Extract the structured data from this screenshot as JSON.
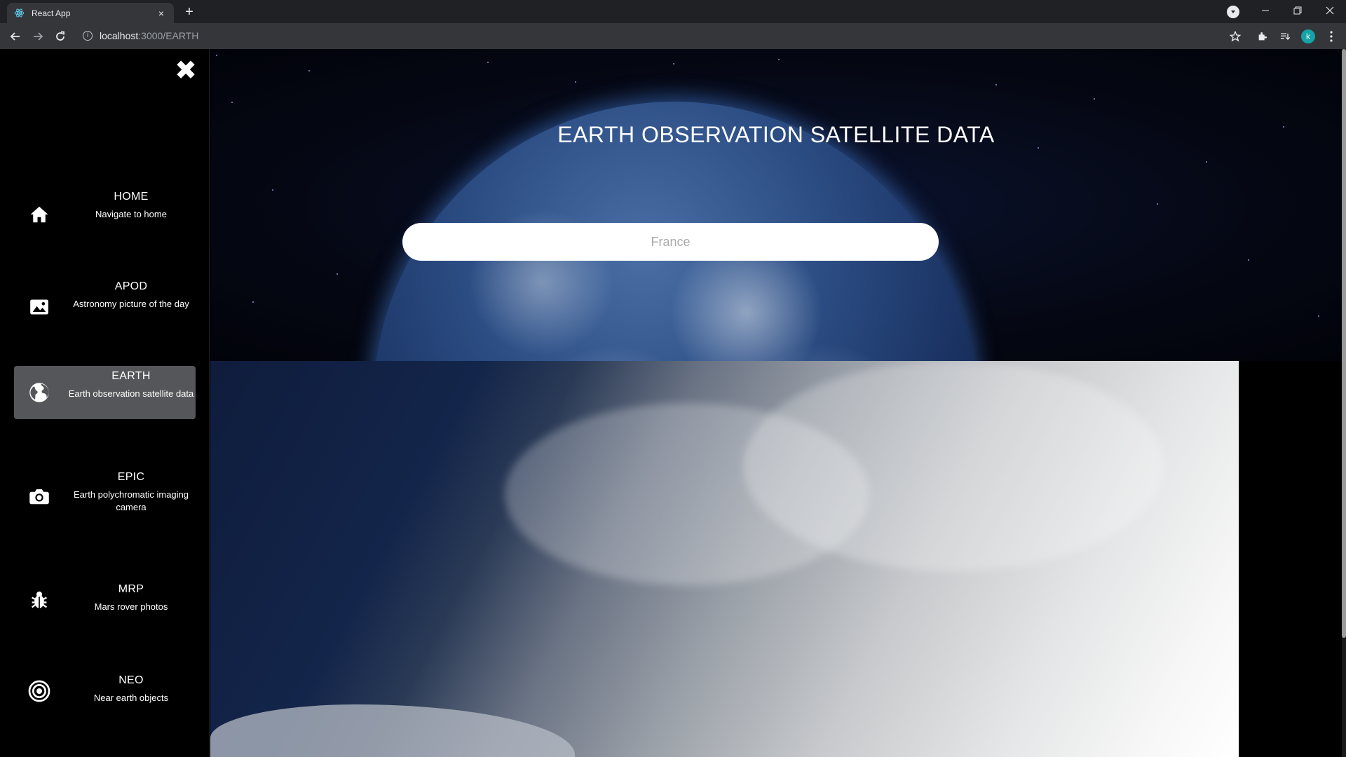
{
  "browser": {
    "tab_title": "React App",
    "tab_close": "×",
    "new_tab": "+",
    "url_host": "localhost",
    "url_path": ":3000/EARTH",
    "avatar_letter": "k",
    "icons": [
      "back-arrow-icon",
      "forward-arrow-icon",
      "reload-icon",
      "info-icon",
      "star-icon",
      "extensions-icon",
      "reading-list-icon",
      "more-vertical-icon",
      "minimize-icon",
      "restore-icon",
      "close-icon"
    ]
  },
  "sidebar": {
    "close_symbol": "✖",
    "items": [
      {
        "title": "HOME",
        "subtitle": "Navigate to home",
        "icon": "home-icon",
        "active": false
      },
      {
        "title": "APOD",
        "subtitle": "Astronomy picture of the day",
        "icon": "image-icon",
        "active": false
      },
      {
        "title": "EARTH",
        "subtitle": "Earth observation satellite data",
        "icon": "globe-icon",
        "active": true
      },
      {
        "title": "EPIC",
        "subtitle": "Earth polychromatic imaging camera",
        "icon": "camera-icon",
        "active": false
      },
      {
        "title": "MRP",
        "subtitle": "Mars rover photos",
        "icon": "bug-icon",
        "active": false
      },
      {
        "title": "NEO",
        "subtitle": "Near earth objects",
        "icon": "target-icon",
        "active": false
      }
    ]
  },
  "main": {
    "title": "EARTH OBSERVATION SATELLITE DATA",
    "search_placeholder": "France"
  },
  "colors": {
    "sidebar_bg": "#000000",
    "active_item_bg": "#555659",
    "chrome_bg": "#202124",
    "toolbar_bg": "#35363a",
    "avatar_bg": "#13a3a8"
  }
}
